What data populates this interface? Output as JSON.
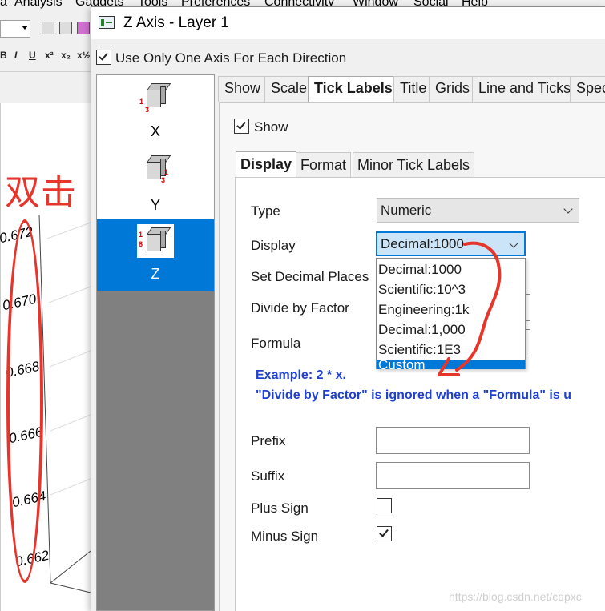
{
  "app": {
    "menu": [
      "a",
      "Analysis",
      "Gadgets",
      "Tools",
      "Preferences",
      "Connectivity",
      "Window",
      "Social",
      "Help"
    ],
    "format_bar": [
      "B",
      "I",
      "U",
      "x²",
      "x₂",
      "x½"
    ],
    "plot_ticks": [
      "0.672",
      "0.670",
      "0.668",
      "0.666",
      "0.664",
      "0.662"
    ],
    "annotation_text": "双击",
    "annotation_color": "#e8352b"
  },
  "dialog": {
    "title": "Z Axis - Layer 1",
    "use_one_axis": {
      "label": "Use Only One Axis For Each Direction",
      "checked": true
    },
    "axes": [
      {
        "name": "X",
        "selected": false,
        "icon": "cube-x-axis-icon"
      },
      {
        "name": "Y",
        "selected": false,
        "icon": "cube-y-axis-icon"
      },
      {
        "name": "Z",
        "selected": true,
        "icon": "cube-z-axis-icon"
      }
    ],
    "tabs": [
      "Show",
      "Scale",
      "Tick Labels",
      "Title",
      "Grids",
      "Line and Ticks",
      "Spec"
    ],
    "active_tab": "Tick Labels",
    "show": {
      "label": "Show",
      "checked": true
    },
    "sub_tabs": [
      "Display",
      "Format",
      "Minor Tick Labels"
    ],
    "active_sub_tab": "Display",
    "fields": {
      "type": {
        "label": "Type",
        "value": "Numeric"
      },
      "display": {
        "label": "Display",
        "value": "Decimal:1000"
      },
      "decimal_places": {
        "label": "Set Decimal Places"
      },
      "divide_by_factor": {
        "label": "Divide by Factor"
      },
      "formula": {
        "label": "Formula"
      },
      "prefix": {
        "label": "Prefix",
        "value": ""
      },
      "suffix": {
        "label": "Suffix",
        "value": ""
      },
      "plus_sign": {
        "label": "Plus Sign",
        "checked": false
      },
      "minus_sign": {
        "label": "Minus Sign",
        "checked": true
      }
    },
    "note_line1": "Example: 2 * x.",
    "note_line2": "\"Divide by Factor\" is ignored when a \"Formula\" is u",
    "display_options": [
      "Decimal:1000",
      "Scientific:10^3",
      "Engineering:1k",
      "Decimal:1,000",
      "Scientific:1E3",
      "Custom"
    ],
    "highlighted_option": "Custom"
  },
  "watermark": "https://blog.csdn.net/cdpxc",
  "colors": {
    "accent": "#0078d7",
    "note": "#1f3fcf"
  }
}
